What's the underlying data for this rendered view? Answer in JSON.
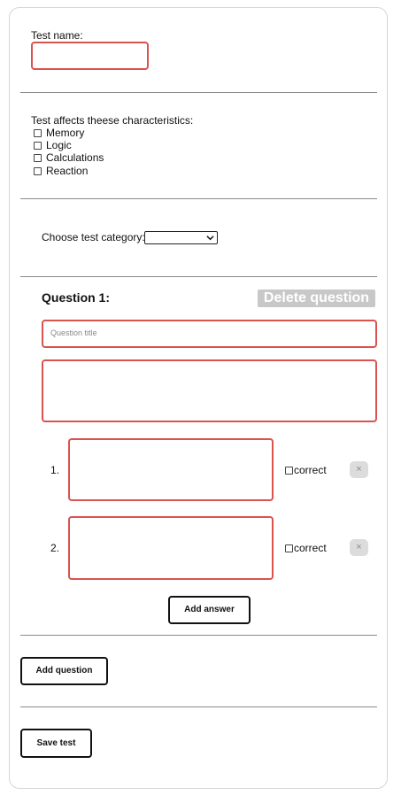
{
  "form": {
    "test_name_label": "Test name:",
    "test_name_value": "",
    "characteristics_label": "Test affects theese characteristics:",
    "characteristics": [
      {
        "label": "Memory",
        "checked": false
      },
      {
        "label": "Logic",
        "checked": false
      },
      {
        "label": "Calculations",
        "checked": false
      },
      {
        "label": "Reaction",
        "checked": false
      }
    ],
    "category_label": "Choose test category:",
    "category_value": ""
  },
  "question": {
    "heading": "Question 1:",
    "delete_label": "Delete question",
    "title_placeholder": "Question title",
    "answers": [
      {
        "number": "1.",
        "correct_label": "correct",
        "remove_icon": "×"
      },
      {
        "number": "2.",
        "correct_label": "correct",
        "remove_icon": "×"
      }
    ],
    "add_answer_label": "Add answer"
  },
  "actions": {
    "add_question_label": "Add question",
    "save_test_label": "Save test"
  },
  "colors": {
    "error_border": "#d9534f",
    "disabled_button": "#c8c8c8"
  }
}
